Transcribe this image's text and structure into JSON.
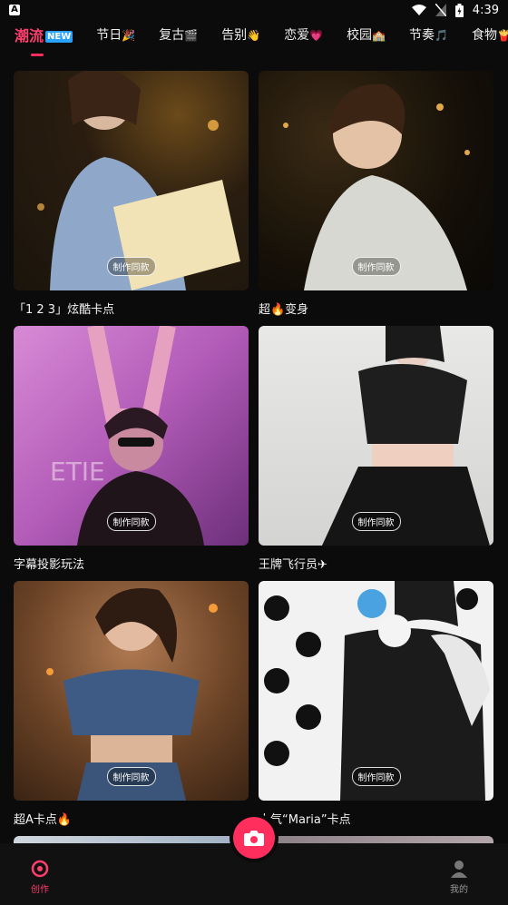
{
  "status": {
    "left_badge": "A",
    "time": "4:39"
  },
  "tabs": [
    {
      "label": "潮流",
      "badge": "NEW"
    },
    {
      "label": "节日",
      "emoji": "🎉"
    },
    {
      "label": "复古",
      "emoji": "🎬"
    },
    {
      "label": "告别",
      "emoji": "👋"
    },
    {
      "label": "恋爱",
      "emoji": "💗"
    },
    {
      "label": "校园",
      "emoji": "🏫"
    },
    {
      "label": "节奏",
      "emoji": "🎵"
    },
    {
      "label": "食物",
      "emoji": "🍟"
    }
  ],
  "cards": [
    {
      "title": "「1 2 3」炫酷卡点",
      "made_label": "制作同款"
    },
    {
      "title": "超🔥变身",
      "made_label": "制作同款"
    },
    {
      "title": "字幕投影玩法",
      "made_label": "制作同款"
    },
    {
      "title": "王牌飞行员✈",
      "made_label": "制作同款"
    },
    {
      "title": "超A卡点🔥",
      "made_label": "制作同款"
    },
    {
      "title": "人气“Maria”卡点",
      "made_label": "制作同款"
    }
  ],
  "bottom_nav": {
    "create": "创作",
    "mine": "我的"
  },
  "colors": {
    "accent": "#ff2e5c",
    "background": "#0b0b0b"
  }
}
